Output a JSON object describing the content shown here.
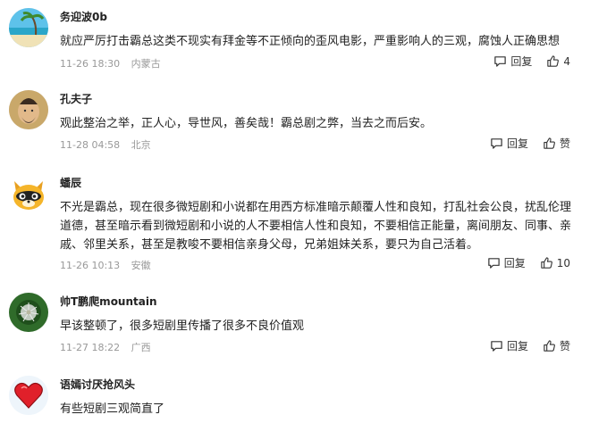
{
  "comments": [
    {
      "username": "务迎波0b",
      "avatar_icon": "beach-avatar-icon",
      "content": "就应严厉打击霸总这类不现实有拜金等不正倾向的歪风电影，严重影响人的三观，腐蚀人正确思想",
      "date": "11-26 18:30",
      "location": "内蒙古",
      "reply_label": "回复",
      "like_label": "4"
    },
    {
      "username": "孔夫子",
      "avatar_icon": "confucius-avatar-icon",
      "content": "观此整治之举，正人心，导世风，善矣哉！霸总剧之弊，当去之而后安。",
      "date": "11-28 04:58",
      "location": "北京",
      "reply_label": "回复",
      "like_label": "赞"
    },
    {
      "username": "蟠辰",
      "avatar_icon": "raccoon-avatar-icon",
      "content": "不光是霸总，现在很多微短剧和小说都在用西方标准暗示颠覆人性和良知，打乱社会公良，扰乱伦理道德，甚至暗示看到微短剧和小说的人不要相信人性和良知，不要相信正能量，离间朋友、同事、亲戚、邻里关系，甚至是教唆不要相信亲身父母，兄弟姐妹关系，要只为自己活着。",
      "date": "11-26 10:13",
      "location": "安徽",
      "reply_label": "回复",
      "like_label": "10"
    },
    {
      "username": "帅T鹏爬mountain",
      "avatar_icon": "dandelion-avatar-icon",
      "content": "早该整顿了，很多短剧里传播了很多不良价值观",
      "date": "11-27 18:22",
      "location": "广西",
      "reply_label": "回复",
      "like_label": "赞"
    },
    {
      "username": "语嫣讨厌抢风头",
      "avatar_icon": "heart-avatar-icon",
      "content": "有些短剧三观简直了",
      "date": "",
      "location": "",
      "reply_label": "",
      "like_label": ""
    }
  ]
}
